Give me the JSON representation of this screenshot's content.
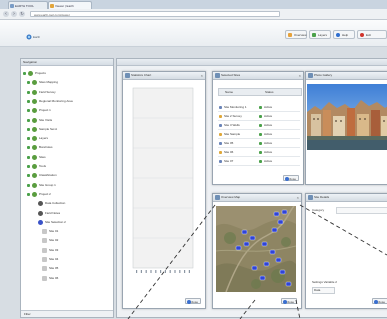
{
  "browser": {
    "tabs": [
      {
        "label": "EARTH TOOL"
      },
      {
        "label": "Viewer | Earth"
      }
    ],
    "url": "www.earth-tool.com/viewer",
    "nav_icons": [
      "back-icon",
      "forward-icon",
      "reload-icon"
    ]
  },
  "header": {
    "logo_text": "Earth",
    "buttons": [
      {
        "label": "Overview",
        "icon": "globe-icon",
        "color": "#e6a23c"
      },
      {
        "label": "Layers",
        "icon": "layers-icon",
        "color": "#4aa14a"
      },
      {
        "label": "Help",
        "icon": "help-icon",
        "color": "#2f6fd0"
      },
      {
        "label": "Exit",
        "icon": "exit-icon",
        "color": "#d0342c"
      }
    ]
  },
  "sidebar": {
    "title": "Navigation",
    "items": [
      {
        "label": "Projects",
        "level": 0
      },
      {
        "label": "Sites Mapping",
        "level": 1
      },
      {
        "label": "Field Survey",
        "level": 1
      },
      {
        "label": "Regional Monitoring Area",
        "level": 1
      },
      {
        "label": "Project 1",
        "level": 1
      },
      {
        "label": "Site Visits",
        "level": 1
      },
      {
        "label": "Sample Set A",
        "level": 1
      },
      {
        "label": "Layers",
        "level": 1
      },
      {
        "label": "Boreholes",
        "level": 1
      },
      {
        "label": "Sites",
        "level": 1
      },
      {
        "label": "Tools",
        "level": 1
      },
      {
        "label": "Classification",
        "level": 1
      },
      {
        "label": "Site Group 1",
        "level": 1
      },
      {
        "label": "Project 2",
        "level": 1
      },
      {
        "label": "Data Collection",
        "level": 2
      },
      {
        "label": "Field Notes",
        "level": 2
      },
      {
        "label": "Site Selection 2",
        "level": 2
      },
      {
        "label": "Site 01",
        "level": 3
      },
      {
        "label": "Site 02",
        "level": 3
      },
      {
        "label": "Site 03",
        "level": 3
      },
      {
        "label": "Site 04",
        "level": 3
      },
      {
        "label": "Site 05",
        "level": 3
      },
      {
        "label": "Site 06",
        "level": 3
      }
    ],
    "footer": "Filter"
  },
  "panel_chart": {
    "title": "Statistics Chart",
    "ok_label": "Close"
  },
  "panel_list": {
    "title": "Selected Sites",
    "columns": [
      "Name",
      "Status"
    ],
    "rows": [
      {
        "name": "Site Monitoring 1",
        "status": "Active"
      },
      {
        "name": "Site 2 Survey",
        "status": "Active"
      },
      {
        "name": "Site 3 Wells",
        "status": "Active"
      },
      {
        "name": "Site Sample",
        "status": "Active"
      },
      {
        "name": "Site 05",
        "status": "Active"
      },
      {
        "name": "Site 06",
        "status": "Active"
      },
      {
        "name": "Site 07",
        "status": "Active"
      }
    ],
    "ok_label": "Close"
  },
  "panel_photo": {
    "title": "Photo Gallery"
  },
  "panel_map": {
    "title": "Overview Map",
    "ok_label": "Close"
  },
  "panel_details": {
    "title": "Site Details",
    "field_label": "Category",
    "value": "Settings Variable 2",
    "sub_value": "Data",
    "ok_label": "Close"
  },
  "colors": {
    "marker": "#2f44d8",
    "tree_icon": "#5a9d3f"
  }
}
